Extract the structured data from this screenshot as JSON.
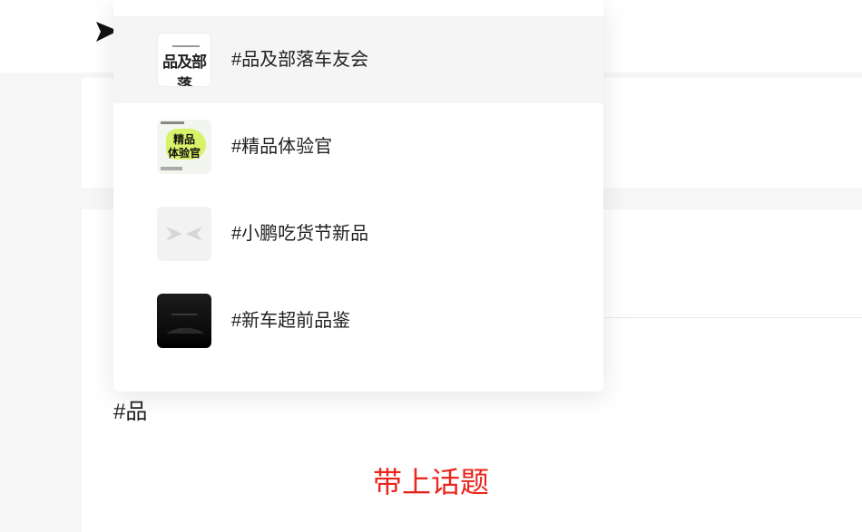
{
  "editor": {
    "typed_text": "#品",
    "caption": "带上话题"
  },
  "topic_dropdown": {
    "items": [
      {
        "label": "#品及部落车友会",
        "thumb_text": "品及部落",
        "icon": "tribe-logo-icon",
        "highlighted": true
      },
      {
        "label": "#精品体验官",
        "thumb_line1": "精品",
        "thumb_line2": "体验官",
        "icon": "experience-officer-icon",
        "highlighted": false
      },
      {
        "label": "#小鹏吃货节新品",
        "icon": "xpeng-logo-icon",
        "highlighted": false
      },
      {
        "label": "#新车超前品鉴",
        "icon": "dark-car-image-icon",
        "highlighted": false
      }
    ]
  },
  "colors": {
    "caption": "#e8261d",
    "highlight": "#f5f5f5",
    "page_bg": "#f6f6f6"
  }
}
